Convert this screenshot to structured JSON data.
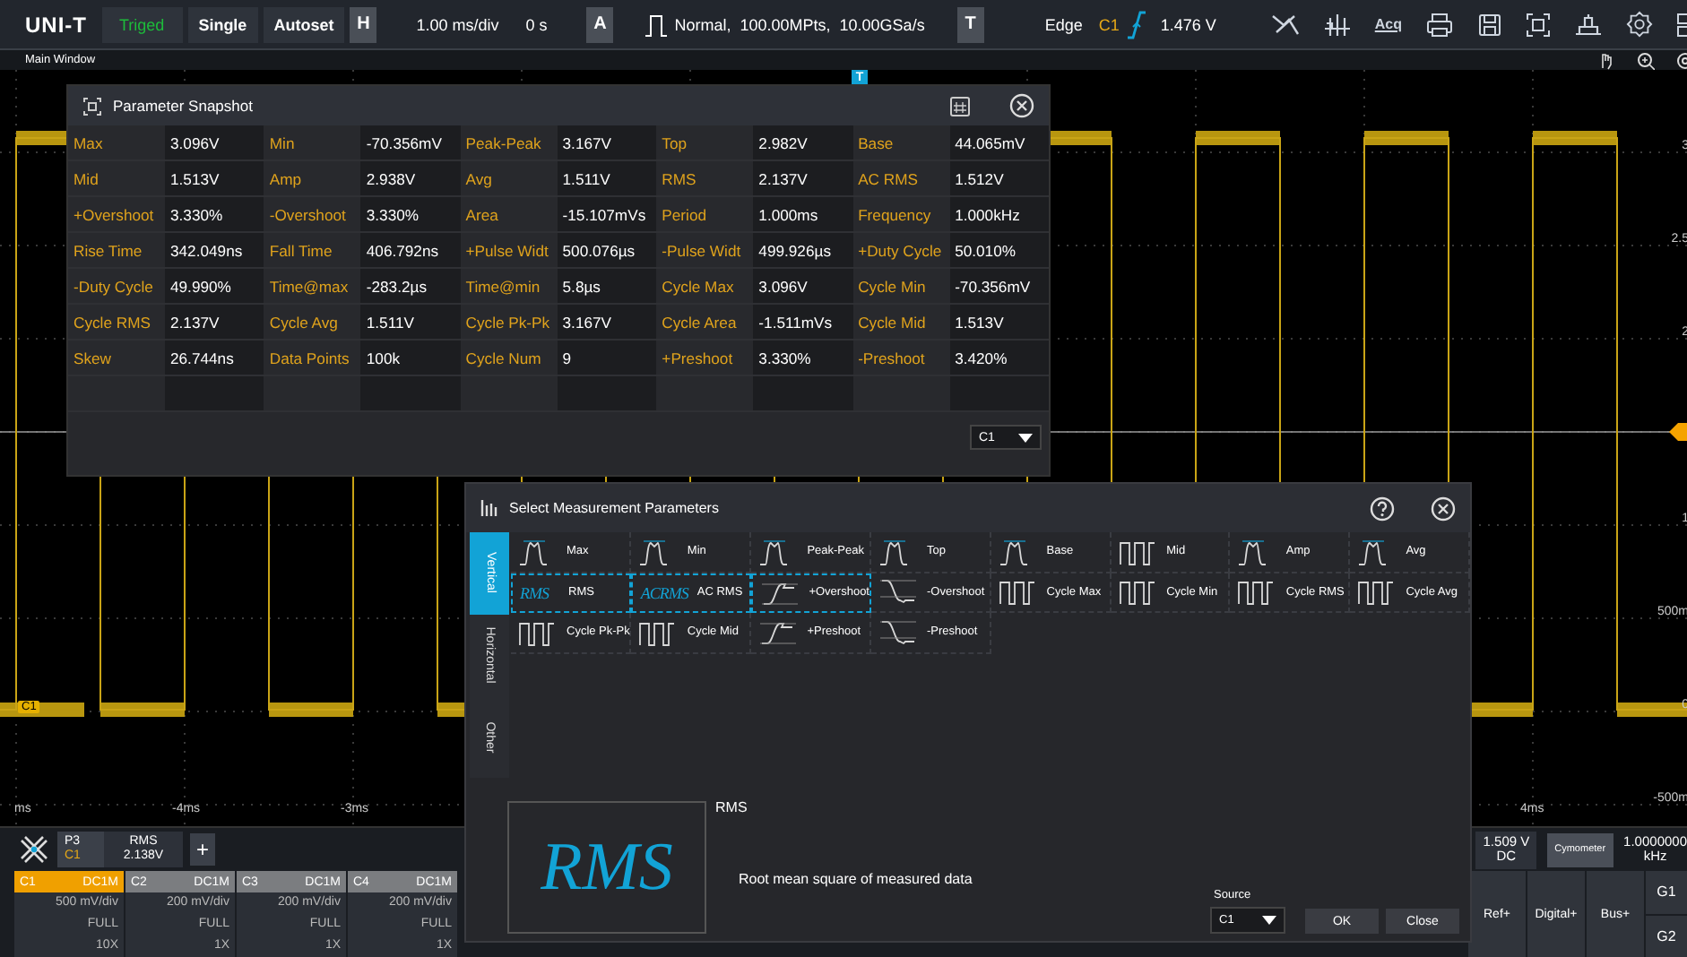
{
  "toolbar": {
    "logo": "UNI-T",
    "buttons": [
      {
        "label": "Triged",
        "kind": "status"
      },
      {
        "label": "Single",
        "kind": "button"
      },
      {
        "label": "Autoset",
        "kind": "button"
      }
    ],
    "horizontal": {
      "key": "H",
      "scale": "1.00 ms/div",
      "offset": "0 s"
    },
    "acquire": {
      "key": "A",
      "mode": "Normal,  100.00MPts,  10.00GSa/s"
    },
    "trigger": {
      "key": "T",
      "type": "Edge",
      "source": "C1",
      "level": "1.476 V"
    },
    "acq_label": "Acq"
  },
  "subbar": {
    "title": "Main Window"
  },
  "waveform": {
    "y_labels": [
      "3",
      "2.5",
      "2",
      "1",
      "500m",
      "0",
      "-500m"
    ],
    "x_labels": [
      "ms",
      "-4ms",
      "-3ms",
      "4ms"
    ],
    "channel_marker": "C1",
    "trigger_marker": "T"
  },
  "snapshot": {
    "title": "Parameter Snapshot",
    "source": "C1",
    "rows": [
      [
        {
          "name": "Max",
          "value": "3.096V"
        },
        {
          "name": "Min",
          "value": "-70.356mV"
        },
        {
          "name": "Peak-Peak",
          "value": "3.167V"
        },
        {
          "name": "Top",
          "value": "2.982V"
        },
        {
          "name": "Base",
          "value": "44.065mV"
        }
      ],
      [
        {
          "name": "Mid",
          "value": "1.513V"
        },
        {
          "name": "Amp",
          "value": "2.938V"
        },
        {
          "name": "Avg",
          "value": "1.511V"
        },
        {
          "name": "RMS",
          "value": "2.137V"
        },
        {
          "name": "AC RMS",
          "value": "1.512V"
        }
      ],
      [
        {
          "name": "+Overshoot",
          "value": "3.330%"
        },
        {
          "name": "-Overshoot",
          "value": "3.330%"
        },
        {
          "name": "Area",
          "value": "-15.107mVs"
        },
        {
          "name": "Period",
          "value": "1.000ms"
        },
        {
          "name": "Frequency",
          "value": "1.000kHz"
        }
      ],
      [
        {
          "name": "Rise Time",
          "value": "342.049ns"
        },
        {
          "name": "Fall Time",
          "value": "406.792ns"
        },
        {
          "name": "+Pulse Widt",
          "value": "500.076µs"
        },
        {
          "name": "-Pulse Widt",
          "value": "499.926µs"
        },
        {
          "name": "+Duty Cycle",
          "value": "50.010%"
        }
      ],
      [
        {
          "name": "-Duty Cycle",
          "value": "49.990%"
        },
        {
          "name": "Time@max",
          "value": "-283.2µs"
        },
        {
          "name": "Time@min",
          "value": "5.8µs"
        },
        {
          "name": "Cycle Max",
          "value": "3.096V"
        },
        {
          "name": "Cycle Min",
          "value": "-70.356mV"
        }
      ],
      [
        {
          "name": "Cycle RMS",
          "value": "2.137V"
        },
        {
          "name": "Cycle Avg",
          "value": "1.511V"
        },
        {
          "name": "Cycle Pk-Pk",
          "value": "3.167V"
        },
        {
          "name": "Cycle Area",
          "value": "-1.511mVs"
        },
        {
          "name": "Cycle Mid",
          "value": "1.513V"
        }
      ],
      [
        {
          "name": "Skew",
          "value": "26.744ns"
        },
        {
          "name": "Data Points",
          "value": "100k"
        },
        {
          "name": "Cycle Num",
          "value": "9"
        },
        {
          "name": "+Preshoot",
          "value": "3.330%"
        },
        {
          "name": "-Preshoot",
          "value": "3.420%"
        }
      ]
    ]
  },
  "measure_dialog": {
    "title": "Select Measurement Parameters",
    "tabs": [
      {
        "label": "Vertical",
        "selected": true
      },
      {
        "label": "Horizontal",
        "selected": false
      },
      {
        "label": "Other",
        "selected": false
      }
    ],
    "items": [
      {
        "name": "Max",
        "kind": "pulse",
        "selected": false
      },
      {
        "name": "Min",
        "kind": "pulse",
        "selected": false
      },
      {
        "name": "Peak-Peak",
        "kind": "pulse",
        "selected": false
      },
      {
        "name": "Top",
        "kind": "pulse",
        "selected": false
      },
      {
        "name": "Base",
        "kind": "pulse",
        "selected": false
      },
      {
        "name": "Mid",
        "kind": "cycles",
        "selected": false
      },
      {
        "name": "Amp",
        "kind": "pulse",
        "selected": false
      },
      {
        "name": "Avg",
        "kind": "pulse",
        "selected": false
      },
      {
        "name": "RMS",
        "kind": "glyph",
        "glyph": "RMS",
        "selected": true
      },
      {
        "name": "AC RMS",
        "kind": "glyph",
        "glyph": "ACRMS",
        "selected": true
      },
      {
        "name": "+Overshoot",
        "kind": "rise",
        "selected": true
      },
      {
        "name": "-Overshoot",
        "kind": "fall",
        "selected": false
      },
      {
        "name": "Cycle Max",
        "kind": "cycles",
        "selected": false
      },
      {
        "name": "Cycle Min",
        "kind": "cycles",
        "selected": false
      },
      {
        "name": "Cycle RMS",
        "kind": "cycles",
        "selected": false
      },
      {
        "name": "Cycle Avg",
        "kind": "cycles",
        "selected": false
      },
      {
        "name": "Cycle Pk-Pk",
        "kind": "cycles",
        "selected": false
      },
      {
        "name": "Cycle Mid",
        "kind": "cycles",
        "selected": false
      },
      {
        "name": "+Preshoot",
        "kind": "rise",
        "selected": false
      },
      {
        "name": "-Preshoot",
        "kind": "fall",
        "selected": false
      }
    ],
    "preview": {
      "glyph": "RMS",
      "name": "RMS",
      "description": "Root mean square of measured data"
    },
    "source_label": "Source",
    "source": "C1",
    "buttons": [
      "OK",
      "Close"
    ]
  },
  "measure_bar": {
    "slot": "P3",
    "source": "C1",
    "name": "RMS",
    "value": "2.138V",
    "add": "+"
  },
  "dvm": {
    "value": "1.509 V",
    "mode": "DC"
  },
  "cymometer": {
    "label": "Cymometer",
    "value": "1.0000000",
    "unit": "kHz"
  },
  "channels": [
    {
      "name": "C1",
      "coupling": "DC1M",
      "scale": "500 mV/div",
      "bandwidth": "FULL",
      "probe": "10X",
      "selected": true
    },
    {
      "name": "C2",
      "coupling": "DC1M",
      "scale": "200 mV/div",
      "bandwidth": "FULL",
      "probe": "1X",
      "selected": false
    },
    {
      "name": "C3",
      "coupling": "DC1M",
      "scale": "200 mV/div",
      "bandwidth": "FULL",
      "probe": "1X",
      "selected": false
    },
    {
      "name": "C4",
      "coupling": "DC1M",
      "scale": "200 mV/div",
      "bandwidth": "FULL",
      "probe": "1X",
      "selected": false
    }
  ],
  "side_buttons": [
    "Ref+",
    "Digital+",
    "Bus+"
  ],
  "groups": [
    "G1",
    "G2"
  ]
}
